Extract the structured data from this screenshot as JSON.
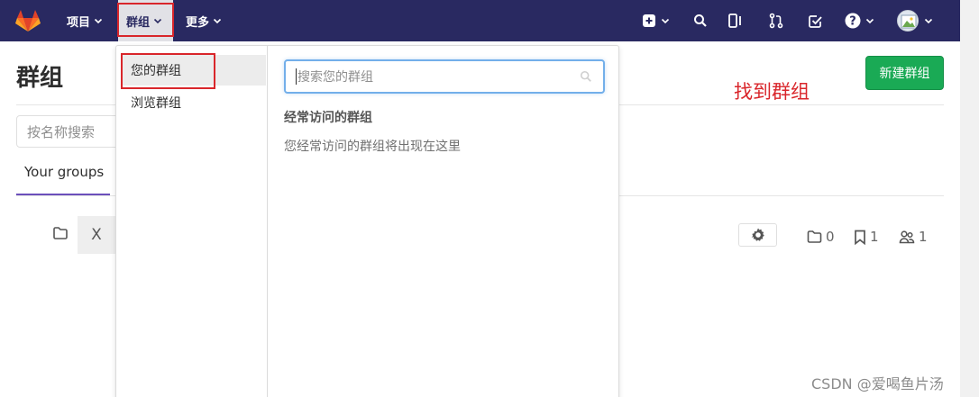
{
  "navbar": {
    "projects_label": "项目",
    "groups_label": "群组",
    "more_label": "更多",
    "icons": [
      "plus-square-icon",
      "search-icon",
      "sidebar-panel-icon",
      "merge-request-icon",
      "todo-check-icon",
      "help-icon",
      "avatar"
    ]
  },
  "dropdown": {
    "sidebar_items": [
      {
        "label": "您的群组",
        "active": true
      },
      {
        "label": "浏览群组",
        "active": false
      }
    ],
    "search_placeholder": "搜索您的群组",
    "frequent_title": "经常访问的群组",
    "frequent_empty": "您经常访问的群组将出现在这里"
  },
  "page": {
    "title": "群组",
    "new_group_button": "新建群组",
    "filter_placeholder": "按名称搜索",
    "tabs": [
      {
        "label": "Your groups",
        "active": true
      }
    ],
    "group_row": {
      "avatar_letter": "X",
      "subgroups": "0",
      "projects": "1",
      "members": "1"
    }
  },
  "annotation": "找到群组",
  "watermark": "CSDN @爱喝鱼片汤",
  "colors": {
    "navbar": "#292961",
    "primary_button": "#1aaa55",
    "highlight": "#d9262b",
    "tab_underline": "#6b4fbb"
  }
}
